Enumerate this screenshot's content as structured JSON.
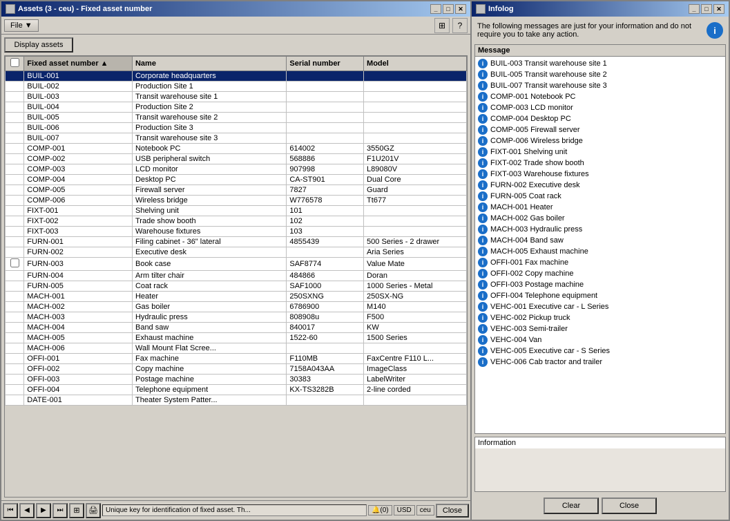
{
  "assets_window": {
    "title": "Assets (3 - ceu) - Fixed asset number",
    "menu": {
      "file_label": "File"
    },
    "display_assets_btn": "Display assets",
    "table": {
      "columns": [
        "Fixed asset number",
        "Name",
        "Serial number",
        "Model"
      ],
      "rows": [
        {
          "asset": "BUIL-001",
          "name": "Corporate headquarters",
          "serial": "",
          "model": "",
          "selected": true
        },
        {
          "asset": "BUIL-002",
          "name": "Production Site 1",
          "serial": "",
          "model": "",
          "selected": false
        },
        {
          "asset": "BUIL-003",
          "name": "Transit warehouse site 1",
          "serial": "",
          "model": "",
          "selected": false
        },
        {
          "asset": "BUIL-004",
          "name": "Production Site 2",
          "serial": "",
          "model": "",
          "selected": false
        },
        {
          "asset": "BUIL-005",
          "name": "Transit warehouse site 2",
          "serial": "",
          "model": "",
          "selected": false
        },
        {
          "asset": "BUIL-006",
          "name": "Production Site 3",
          "serial": "",
          "model": "",
          "selected": false
        },
        {
          "asset": "BUIL-007",
          "name": "Transit warehouse site 3",
          "serial": "",
          "model": "",
          "selected": false
        },
        {
          "asset": "COMP-001",
          "name": "Notebook PC",
          "serial": "614002",
          "model": "3550GZ",
          "selected": false
        },
        {
          "asset": "COMP-002",
          "name": "USB peripheral switch",
          "serial": "568886",
          "model": "F1U201V",
          "selected": false
        },
        {
          "asset": "COMP-003",
          "name": "LCD monitor",
          "serial": "907998",
          "model": "L89080V",
          "selected": false
        },
        {
          "asset": "COMP-004",
          "name": "Desktop PC",
          "serial": "CA-ST901",
          "model": "Dual Core",
          "selected": false
        },
        {
          "asset": "COMP-005",
          "name": "Firewall server",
          "serial": "7827",
          "model": "Guard",
          "selected": false
        },
        {
          "asset": "COMP-006",
          "name": "Wireless bridge",
          "serial": "W776578",
          "model": "Tt677",
          "selected": false
        },
        {
          "asset": "FIXT-001",
          "name": "Shelving unit",
          "serial": "101",
          "model": "",
          "selected": false
        },
        {
          "asset": "FIXT-002",
          "name": "Trade show booth",
          "serial": "102",
          "model": "",
          "selected": false
        },
        {
          "asset": "FIXT-003",
          "name": "Warehouse fixtures",
          "serial": "103",
          "model": "",
          "selected": false
        },
        {
          "asset": "FURN-001",
          "name": "Filing cabinet - 36\" lateral",
          "serial": "4855439",
          "model": "500 Series - 2 drawer",
          "selected": false
        },
        {
          "asset": "FURN-002",
          "name": "Executive desk",
          "serial": "",
          "model": "Aria Series",
          "selected": false
        },
        {
          "asset": "FURN-003",
          "name": "Book case",
          "serial": "SAF8774",
          "model": "Value Mate",
          "selected": false,
          "checkbox": true
        },
        {
          "asset": "FURN-004",
          "name": "Arm tilter chair",
          "serial": "484866",
          "model": "Doran",
          "selected": false
        },
        {
          "asset": "FURN-005",
          "name": "Coat rack",
          "serial": "SAF1000",
          "model": "1000 Series - Metal",
          "selected": false
        },
        {
          "asset": "MACH-001",
          "name": "Heater",
          "serial": "250SXNG",
          "model": "250SX-NG",
          "selected": false
        },
        {
          "asset": "MACH-002",
          "name": "Gas boiler",
          "serial": "6786900",
          "model": "M140",
          "selected": false
        },
        {
          "asset": "MACH-003",
          "name": "Hydraulic press",
          "serial": "808908u",
          "model": "F500",
          "selected": false
        },
        {
          "asset": "MACH-004",
          "name": "Band saw",
          "serial": "840017",
          "model": "KW",
          "selected": false
        },
        {
          "asset": "MACH-005",
          "name": "Exhaust machine",
          "serial": "1522-60",
          "model": "1500 Series",
          "selected": false
        },
        {
          "asset": "MACH-006",
          "name": "Wall Mount Flat Scree...",
          "serial": "",
          "model": "",
          "selected": false
        },
        {
          "asset": "OFFI-001",
          "name": "Fax machine",
          "serial": "F110MB",
          "model": "FaxCentre F110 L...",
          "selected": false
        },
        {
          "asset": "OFFI-002",
          "name": "Copy machine",
          "serial": "7158A043AA",
          "model": "ImageClass",
          "selected": false
        },
        {
          "asset": "OFFI-003",
          "name": "Postage machine",
          "serial": "30383",
          "model": "LabelWriter",
          "selected": false
        },
        {
          "asset": "OFFI-004",
          "name": "Telephone equipment",
          "serial": "KX-TS3282B",
          "model": "2-line corded",
          "selected": false
        },
        {
          "asset": "DATE-001",
          "name": "Theater System Patter...",
          "serial": "",
          "model": "",
          "selected": false
        }
      ]
    },
    "status_bar": {
      "nav_buttons": [
        "⏮",
        "◀",
        "▶",
        "⏭"
      ],
      "status_text": "Unique key for identification of fixed asset. Th...",
      "bell_badge": "(0)",
      "currency": "USD",
      "company": "ceu",
      "close_label": "Close"
    }
  },
  "infolog_window": {
    "title": "Infolog",
    "header_text": "The following messages are just for your information and do not require you to take any action.",
    "message_panel_header": "Message",
    "messages": [
      "BUIL-003  Transit warehouse site 1",
      "BUIL-005  Transit warehouse site 2",
      "BUIL-007  Transit warehouse site 3",
      "COMP-001  Notebook PC",
      "COMP-003  LCD monitor",
      "COMP-004  Desktop PC",
      "COMP-005  Firewall server",
      "COMP-006  Wireless bridge",
      "FIXT-001  Shelving unit",
      "FIXT-002  Trade show booth",
      "FIXT-003  Warehouse fixtures",
      "FURN-002  Executive desk",
      "FURN-005  Coat rack",
      "MACH-001  Heater",
      "MACH-002  Gas boiler",
      "MACH-003  Hydraulic press",
      "MACH-004  Band saw",
      "MACH-005  Exhaust machine",
      "OFFI-001  Fax machine",
      "OFFI-002  Copy machine",
      "OFFI-003  Postage machine",
      "OFFI-004  Telephone equipment",
      "VEHC-001  Executive car - L Series",
      "VEHC-002  Pickup truck",
      "VEHC-003  Semi-trailer",
      "VEHC-004  Van",
      "VEHC-005  Executive car - S Series",
      "VEHC-006  Cab tractor and trailer"
    ],
    "information_label": "Information",
    "footer": {
      "clear_label": "Clear",
      "close_label": "Close"
    }
  }
}
